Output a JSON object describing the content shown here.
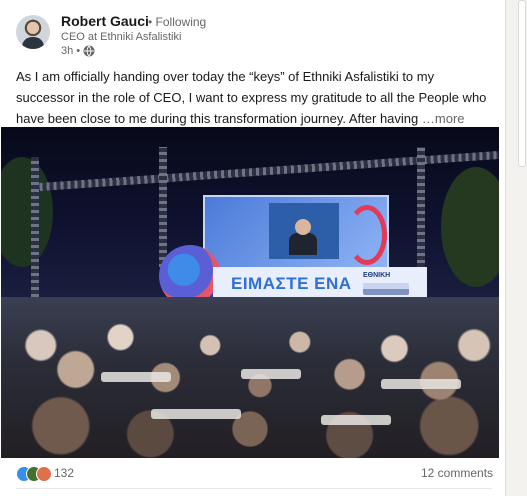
{
  "post": {
    "author": {
      "name": "Robert Gauci",
      "connection": "• Following",
      "headline": "CEO at Ethniki Asfalistiki",
      "time": "3h •"
    },
    "text": "As I am officially handing over today the “keys” of Ethniki Asfalistiki to my successor in the role of CEO, I want to express my gratitude to all the People who have been close to me during this transformation journey. After having",
    "more_label": "…more",
    "image": {
      "banner_text": "ΕΙΜΑΣΤΕ ΕΝΑ",
      "banner_logo": "ΕΘΝΙΚΗ"
    }
  },
  "social": {
    "reaction_icons": [
      "like-icon",
      "celebrate-icon",
      "love-icon"
    ],
    "reaction_count": "132",
    "comments": "12 comments"
  },
  "colors": {
    "like": "#378fe9",
    "celebrate": "#44712e",
    "love": "#df704d",
    "secondary_text": "#666666"
  }
}
